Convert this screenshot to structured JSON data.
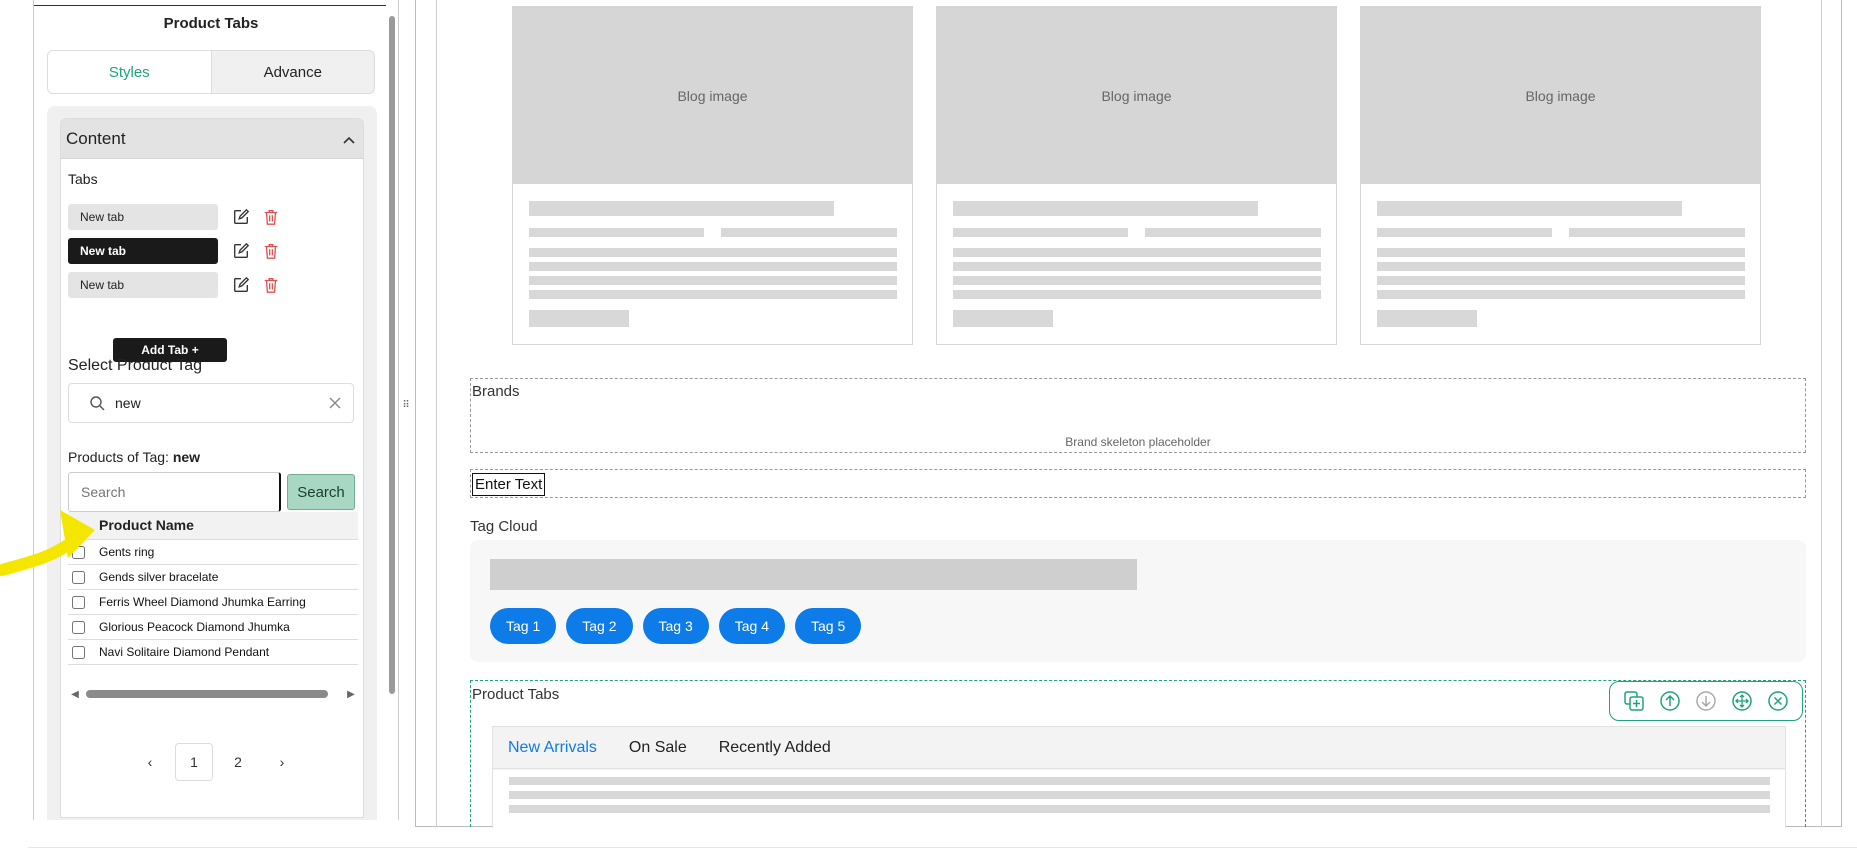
{
  "panel": {
    "title": "Product Tabs",
    "mode_tabs": [
      {
        "label": "Styles",
        "active": true
      },
      {
        "label": "Advance",
        "active": false
      }
    ],
    "content_section": {
      "title": "Content",
      "collapse_icon": "chevron-up-icon",
      "tabs_label": "Tabs",
      "tabs": [
        {
          "label": "New tab",
          "active": false
        },
        {
          "label": "New tab",
          "active": true
        },
        {
          "label": "New tab",
          "active": false
        }
      ],
      "add_tab_label": "Add Tab +",
      "select_tag_label": "Select Product Tag",
      "tag_select_value": "new",
      "products_of_tag_prefix": "Products of Tag:",
      "products_of_tag_value": "new",
      "search_placeholder": "Search",
      "search_button": "Search",
      "table_header": "Product Name",
      "products": [
        "Gents ring",
        "Gends silver bracelate",
        "Ferris Wheel Diamond Jhumka Earring",
        "Glorious Peacock Diamond Jhumka",
        "Navi Solitaire Diamond Pendant"
      ],
      "pagination": {
        "prev": "‹",
        "pages": [
          "1",
          "2"
        ],
        "current": "1",
        "next": "›"
      }
    }
  },
  "canvas": {
    "blog_cards": [
      {
        "image_label": "Blog image"
      },
      {
        "image_label": "Blog image"
      },
      {
        "image_label": "Blog image"
      }
    ],
    "brands": {
      "title": "Brands",
      "placeholder": "Brand skeleton placeholder"
    },
    "enter_text": "Enter Text",
    "tag_cloud": {
      "title": "Tag Cloud",
      "tags": [
        "Tag 1",
        "Tag 2",
        "Tag 3",
        "Tag 4",
        "Tag 5"
      ]
    },
    "product_tabs": {
      "title": "Product Tabs",
      "tabs": [
        "New Arrivals",
        "On Sale",
        "Recently Added"
      ],
      "active_tab": "New Arrivals",
      "toolbar": [
        "duplicate-icon",
        "move-up-icon",
        "move-down-icon",
        "drag-move-icon",
        "close-icon"
      ]
    }
  },
  "colors": {
    "accent_green": "#1fa37a",
    "tag_blue": "#0d7be8",
    "delete_red": "#e05252",
    "annotation_yellow": "#f5e600"
  }
}
